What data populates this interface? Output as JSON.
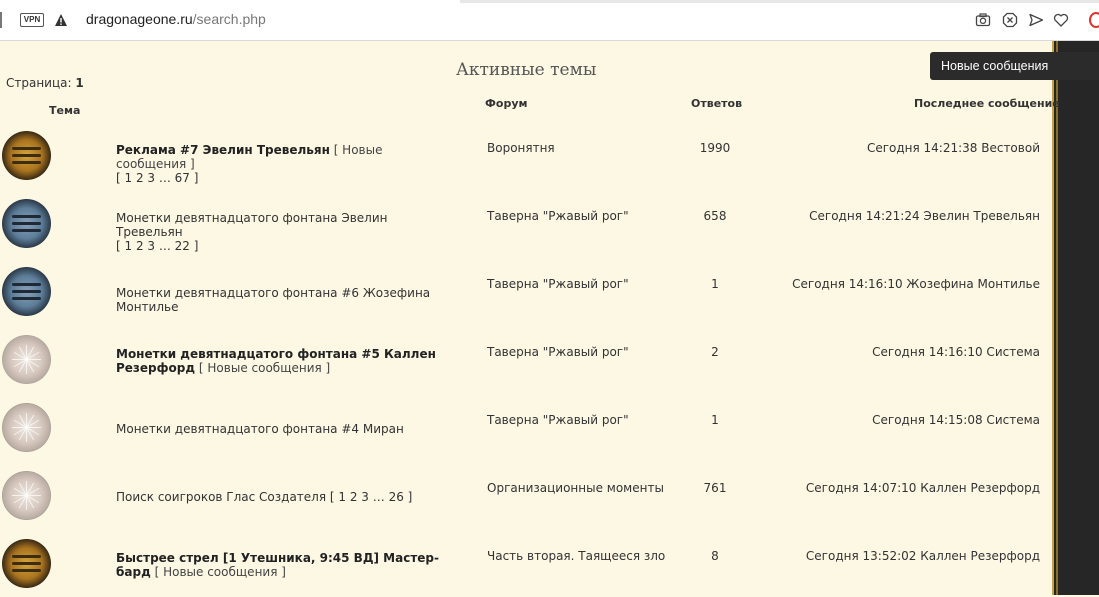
{
  "browser": {
    "vpn_label": "VPN",
    "url_domain": "dragonageone.ru",
    "url_path": "/search.php"
  },
  "tooltip": "Новые сообщения",
  "page": {
    "title": "Активные темы",
    "pager_label": "Страница:",
    "pager_value": "1"
  },
  "columns": {
    "topic": "Тема",
    "forum": "Форум",
    "replies": "Ответов",
    "last": "Последнее сообщение"
  },
  "rows": [
    {
      "avatar": "gold-wave-icon",
      "topic": "Реклама #7 Эвелин Тревельян",
      "bold": true,
      "new": "[ Новые сообщения ]",
      "pages": "[ 1 2 3 … 67 ]",
      "forum": "Воронятня",
      "replies": "1990",
      "last": "Сегодня 14:21:38 Вестовой"
    },
    {
      "avatar": "blue-wave-icon",
      "topic": "Монетки девятнадцатого фонтана Эвелин Тревельян",
      "bold": false,
      "new": "",
      "pages": "[ 1 2 3 … 22 ]",
      "forum": "Таверна \"Ржавый рог\"",
      "replies": "658",
      "last": "Сегодня 14:21:24 Эвелин Тревельян"
    },
    {
      "avatar": "blue-wave-icon",
      "topic": "Монетки девятнадцатого фонтана #6 Жозефина Монтилье",
      "bold": false,
      "new": "",
      "pages": "",
      "forum": "Таверна \"Ржавый рог\"",
      "replies": "1",
      "last": "Сегодня 14:16:10 Жозефина Монтилье"
    },
    {
      "avatar": "pale-rays-icon",
      "topic": "Монетки девятнадцатого фонтана #5 Каллен Резерфорд",
      "bold": true,
      "new": "[ Новые сообщения ]",
      "pages": "",
      "forum": "Таверна \"Ржавый рог\"",
      "replies": "2",
      "last": "Сегодня 14:16:10 Система"
    },
    {
      "avatar": "pale-rays-icon",
      "topic": "Монетки девятнадцатого фонтана #4 Миран",
      "bold": false,
      "new": "",
      "pages": "",
      "forum": "Таверна \"Ржавый рог\"",
      "replies": "1",
      "last": "Сегодня 14:15:08 Система"
    },
    {
      "avatar": "pale-rays-icon",
      "topic": "Поиск соигроков Глас Создателя",
      "bold": false,
      "new": "",
      "pages": "[ 1 2 3 … 26 ]",
      "forum": "Организационные моменты",
      "replies": "761",
      "last": "Сегодня 14:07:10 Каллен Резерфорд"
    },
    {
      "avatar": "gold-wave-icon",
      "topic": "Быстрее стрел [1 Утешника, 9:45 ВД] Мастер-бард",
      "bold": true,
      "new": "[ Новые сообщения ]",
      "pages": "",
      "forum": "Часть вторая. Таящееся зло",
      "replies": "8",
      "last": "Сегодня 13:52:02 Каллен Резерфорд"
    }
  ]
}
